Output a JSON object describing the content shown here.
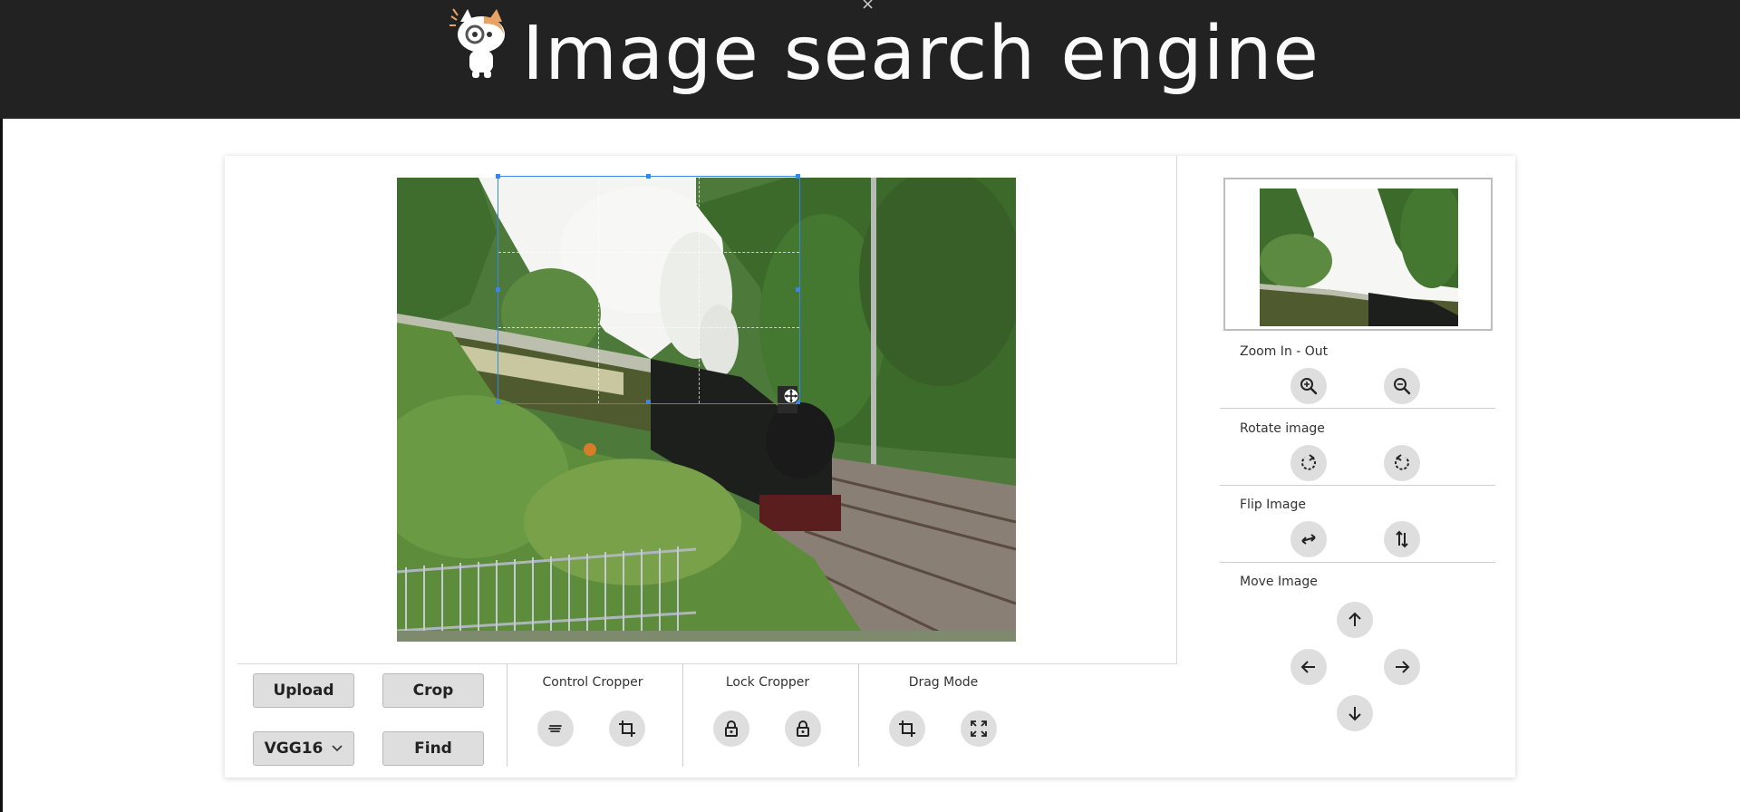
{
  "header": {
    "title": "Image search engine",
    "close_glyph": "×"
  },
  "mascot": {
    "icon": "cat-mascot-icon"
  },
  "toolbar": {
    "upload_label": "Upload",
    "crop_label": "Crop",
    "model_select": {
      "value": "VGG16"
    },
    "find_label": "Find",
    "control_cropper_label": "Control Cropper",
    "lock_cropper_label": "Lock Cropper",
    "drag_mode_label": "Drag Mode"
  },
  "side_panel": {
    "zoom_label": "Zoom In - Out",
    "rotate_label": "Rotate image",
    "flip_label": "Flip Image",
    "move_label": "Move Image"
  },
  "icons": {
    "zoom_in": "zoom-in-icon",
    "zoom_out": "zoom-out-icon",
    "rotate_right": "rotate-right-icon",
    "rotate_left": "rotate-left-icon",
    "flip_horizontal": "flip-horizontal-icon",
    "flip_vertical": "flip-vertical-icon",
    "arrows": [
      "arrow-up-icon",
      "arrow-left-icon",
      "arrow-right-icon",
      "arrow-down-icon"
    ],
    "clear": "clear-crop-icon",
    "crop": "crop-icon",
    "lock": "lock-icon",
    "unlock": "unlock-icon",
    "drag_crop": "crop-mode-icon",
    "drag_move": "move-mode-icon"
  },
  "colors": {
    "header_bg": "#222222",
    "button_bg": "#dedede",
    "crop_border": "#3a85e8"
  }
}
